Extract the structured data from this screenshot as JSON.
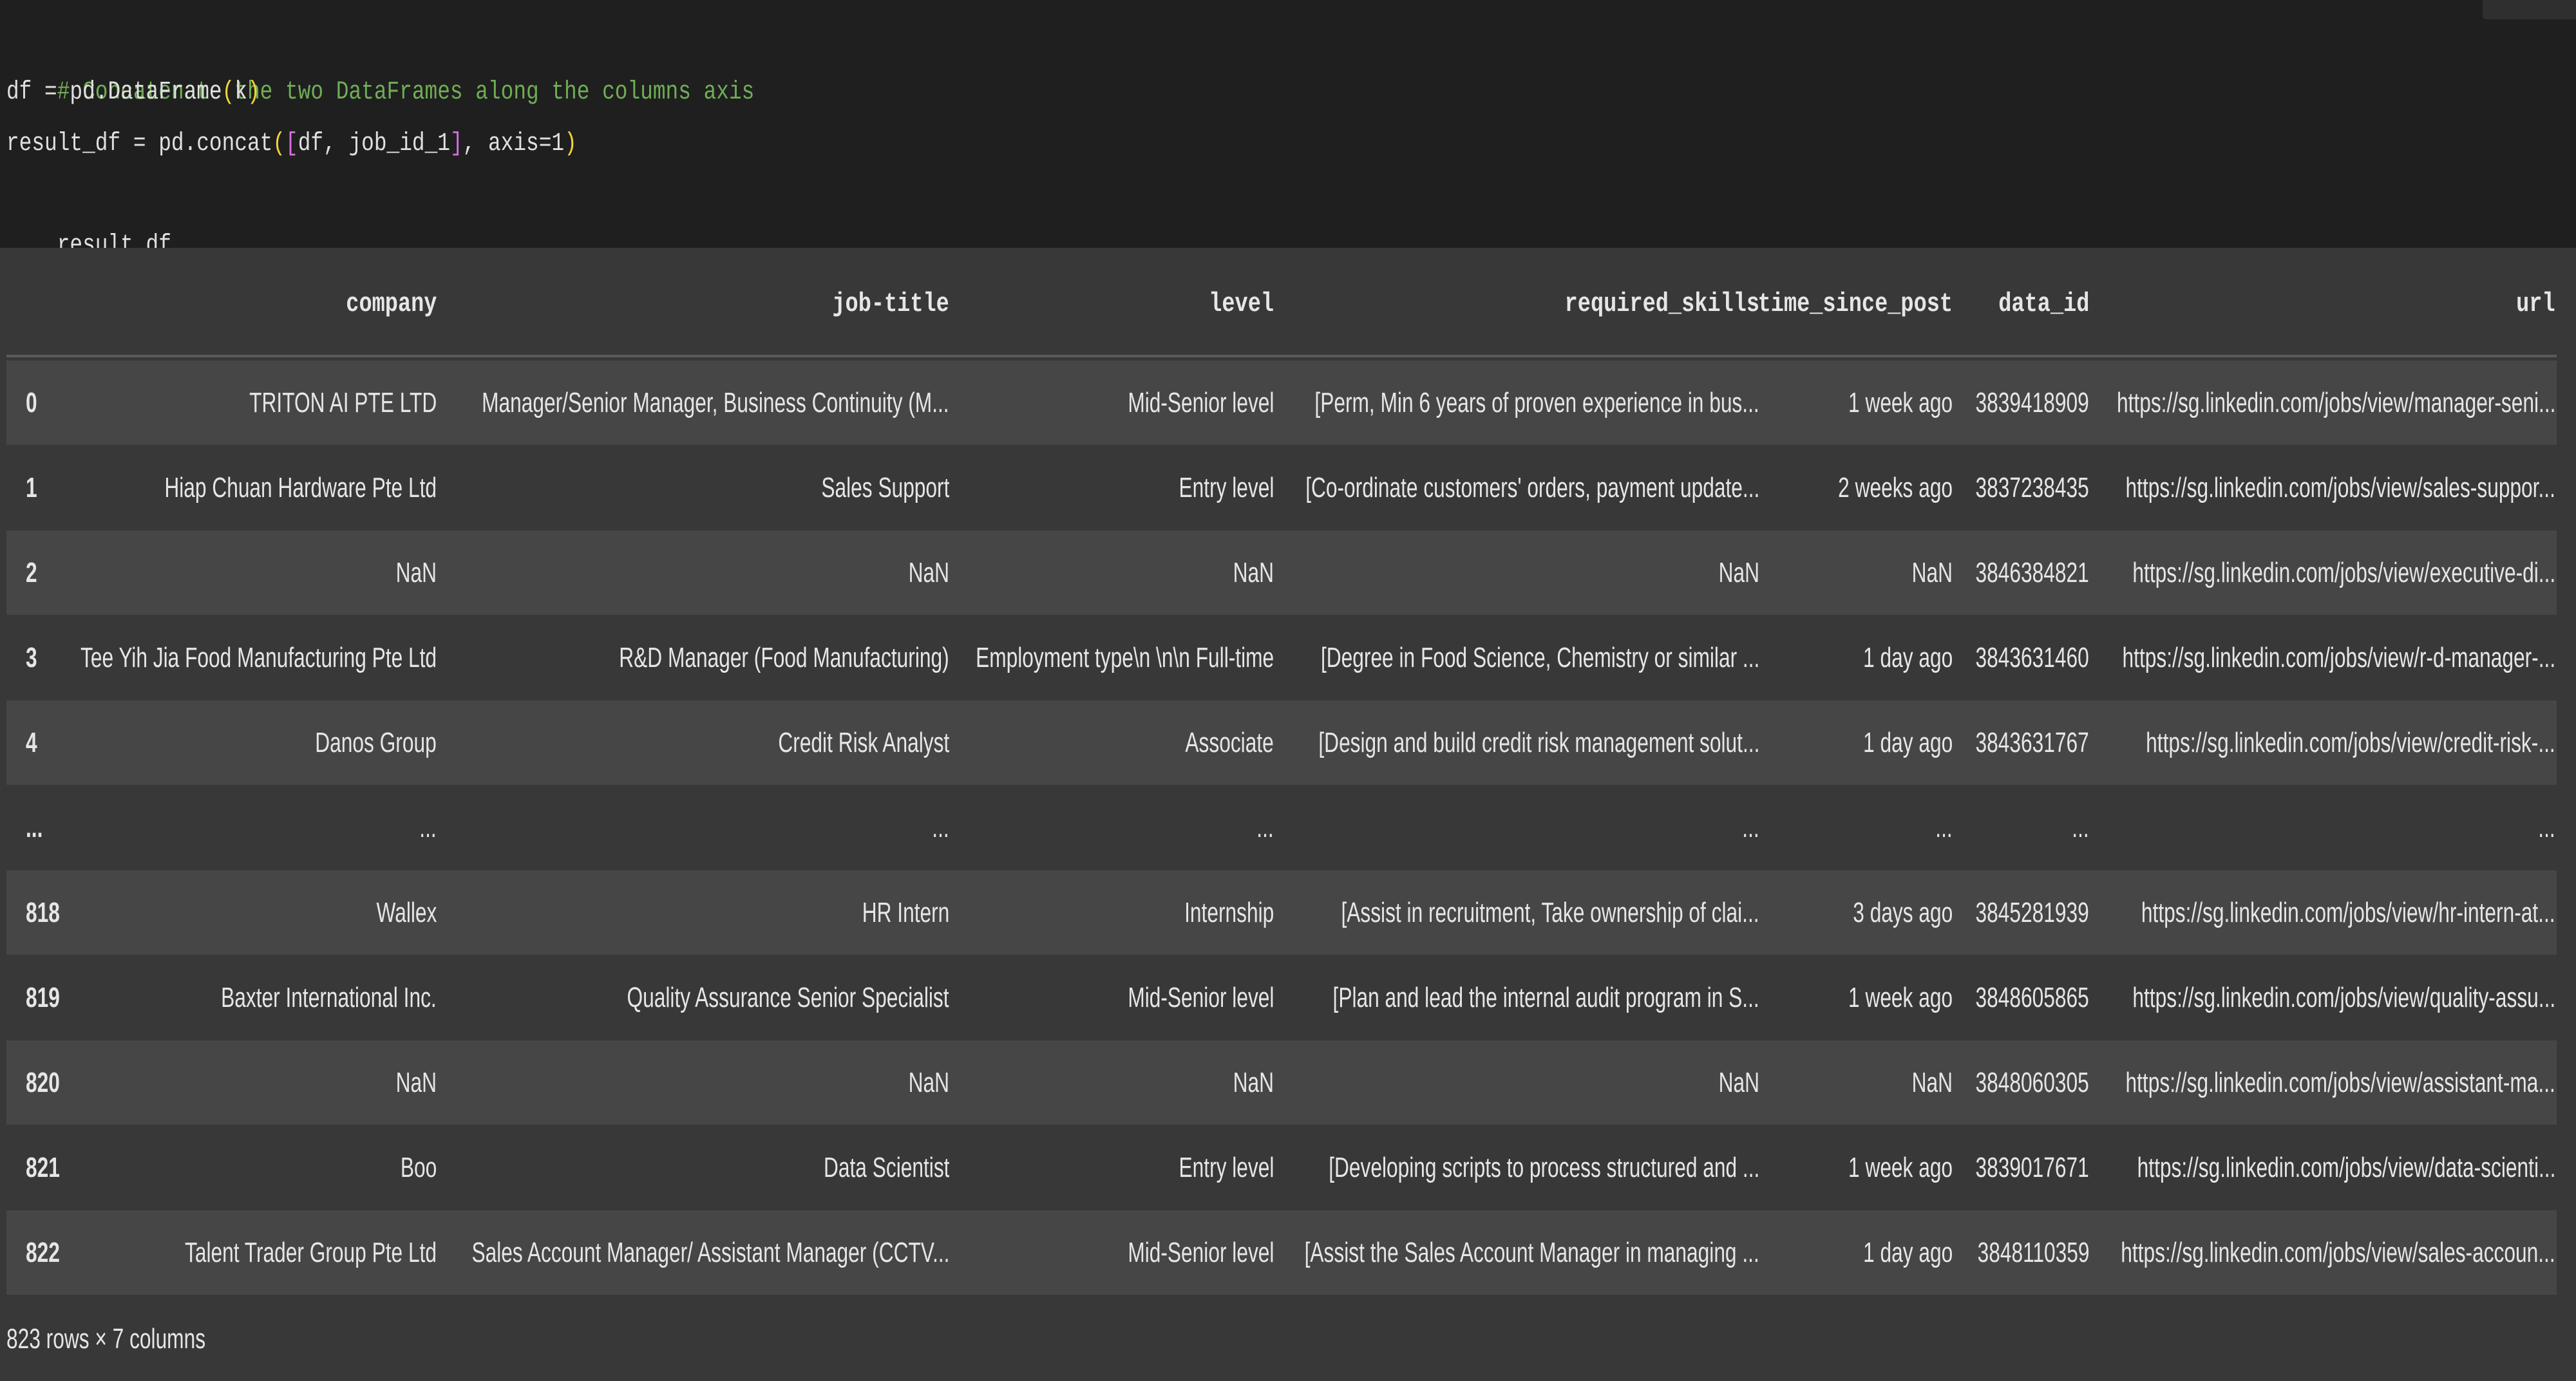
{
  "code": {
    "comment": "# Concatenate the two DataFrames along the columns axis",
    "line2": {
      "prefix": "df = pd.DataFrame",
      "open": "(",
      "arg": "k",
      "close": ")"
    },
    "line3": {
      "prefix": "result_df = pd.concat",
      "open_paren": "(",
      "open_bracket": "[",
      "args": "df, job_id_1",
      "close_bracket": "]",
      "tail": ", axis=1",
      "close_paren": ")"
    },
    "line4": "result_df"
  },
  "table": {
    "columns": [
      "company",
      "job-title",
      "level",
      "required_skills",
      "time_since_post",
      "data_id",
      "url"
    ],
    "rows": [
      {
        "index": "0",
        "company": "TRITON AI PTE LTD",
        "title": "Manager/Senior Manager, Business Continuity (M...",
        "level": "Mid-Senior level",
        "skills": "[Perm, Min 6 years of proven experience in bus...",
        "time": "1 week ago",
        "data_id": "3839418909",
        "url": "https://sg.linkedin.com/jobs/view/manager-seni..."
      },
      {
        "index": "1",
        "company": "Hiap Chuan Hardware Pte Ltd",
        "title": "Sales Support",
        "level": "Entry level",
        "skills": "[Co-ordinate customers' orders, payment update...",
        "time": "2 weeks ago",
        "data_id": "3837238435",
        "url": "https://sg.linkedin.com/jobs/view/sales-suppor..."
      },
      {
        "index": "2",
        "company": "NaN",
        "title": "NaN",
        "level": "NaN",
        "skills": "NaN",
        "time": "NaN",
        "data_id": "3846384821",
        "url": "https://sg.linkedin.com/jobs/view/executive-di..."
      },
      {
        "index": "3",
        "company": "Tee Yih Jia Food Manufacturing Pte Ltd",
        "title": "R&D Manager (Food Manufacturing)",
        "level": "Employment type\\n \\n\\n Full-time",
        "skills": "[Degree in Food Science, Chemistry or similar ...",
        "time": "1 day ago",
        "data_id": "3843631460",
        "url": "https://sg.linkedin.com/jobs/view/r-d-manager-..."
      },
      {
        "index": "4",
        "company": "Danos Group",
        "title": "Credit Risk Analyst",
        "level": "Associate",
        "skills": "[Design and build credit risk management solut...",
        "time": "1 day ago",
        "data_id": "3843631767",
        "url": "https://sg.linkedin.com/jobs/view/credit-risk-..."
      },
      {
        "index": "...",
        "company": "...",
        "title": "...",
        "level": "...",
        "skills": "...",
        "time": "...",
        "data_id": "...",
        "url": "..."
      },
      {
        "index": "818",
        "company": "Wallex",
        "title": "HR Intern",
        "level": "Internship",
        "skills": "[Assist in recruitment, Take ownership of clai...",
        "time": "3 days ago",
        "data_id": "3845281939",
        "url": "https://sg.linkedin.com/jobs/view/hr-intern-at..."
      },
      {
        "index": "819",
        "company": "Baxter International Inc.",
        "title": "Quality Assurance Senior Specialist",
        "level": "Mid-Senior level",
        "skills": "[Plan and lead the internal audit program in S...",
        "time": "1 week ago",
        "data_id": "3848605865",
        "url": "https://sg.linkedin.com/jobs/view/quality-assu..."
      },
      {
        "index": "820",
        "company": "NaN",
        "title": "NaN",
        "level": "NaN",
        "skills": "NaN",
        "time": "NaN",
        "data_id": "3848060305",
        "url": "https://sg.linkedin.com/jobs/view/assistant-ma..."
      },
      {
        "index": "821",
        "company": "Boo",
        "title": "Data Scientist",
        "level": "Entry level",
        "skills": "[Developing scripts to process structured and ...",
        "time": "1 week ago",
        "data_id": "3839017671",
        "url": "https://sg.linkedin.com/jobs/view/data-scienti..."
      },
      {
        "index": "822",
        "company": "Talent Trader Group Pte Ltd",
        "title": "Sales Account Manager/ Assistant Manager (CCTV...",
        "level": "Mid-Senior level",
        "skills": "[Assist the Sales Account Manager in managing ...",
        "time": "1 day ago",
        "data_id": "3848110359",
        "url": "https://sg.linkedin.com/jobs/view/sales-accoun..."
      }
    ]
  },
  "footer": "823 rows × 7 columns"
}
